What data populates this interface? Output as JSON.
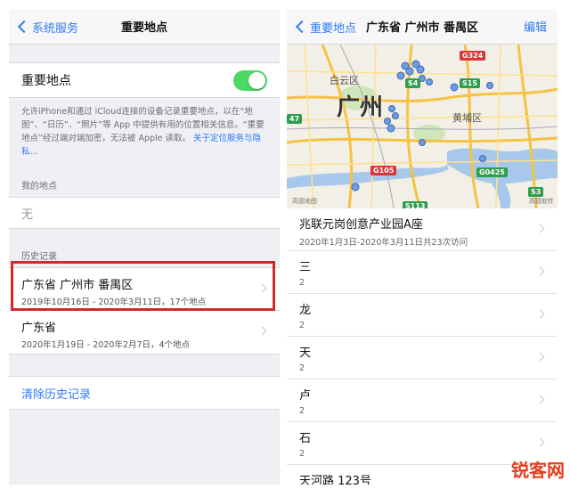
{
  "left": {
    "nav": {
      "back": "系统服务",
      "title": "重要地点"
    },
    "toggle": {
      "label": "重要地点",
      "on": true,
      "color": "#4cd964"
    },
    "description": "允许iPhone和通过 iCloud连接的设备记录重要地点，以在“地图”、“日历”、“照片”等 App 中提供有用的位置相关信息。“重要地点”经过端对端加密，无法被 Apple 读取。",
    "description_link": "关于定位服务与隐私…",
    "my_places": {
      "header": "我的地点",
      "value": "无"
    },
    "history": {
      "header": "历史记录",
      "items": [
        {
          "title": "广东省 广州市 番禺区",
          "subtitle": "2019年10月16日 - 2020年3月11日，17个地点"
        },
        {
          "title": "广东省",
          "subtitle": "2020年1月19日 - 2020年2月7日，4个地点"
        }
      ]
    },
    "clear": "清除历史记录"
  },
  "right": {
    "nav": {
      "back": "重要地点",
      "title": "广东省 广州市 番禺区",
      "edit": "编辑"
    },
    "map": {
      "labels": {
        "baiyun": "白云区",
        "guangzhou": "广州",
        "huangpu": "黄埔区"
      },
      "highways": [
        "G324",
        "S4",
        "S15",
        "G105",
        "G0425",
        "S3",
        "S113",
        "47"
      ],
      "footer_left": "高德地图",
      "footer_right": "高德软件"
    },
    "places": [
      {
        "title": "兆联元岗创意产业园A座",
        "subtitle": "2020年1月3日-2020年3月11日共23次访问"
      },
      {
        "title": "三",
        "subtitle": "2"
      },
      {
        "title": "龙",
        "subtitle": "2"
      },
      {
        "title": "天",
        "subtitle": "2"
      },
      {
        "title": "卢",
        "subtitle": "2"
      },
      {
        "title": "石",
        "subtitle": "2"
      },
      {
        "title": "天河路 123号",
        "subtitle": ""
      }
    ]
  },
  "watermark": "锐客网"
}
